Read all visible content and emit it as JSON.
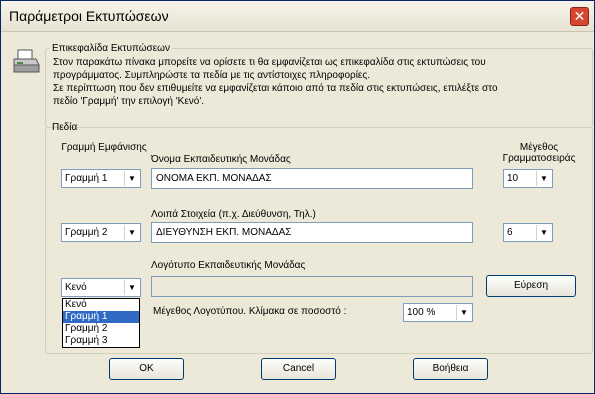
{
  "window": {
    "title": "Παράμετροι Εκτυπώσεων",
    "close_symbol": "✕"
  },
  "icons": {
    "printer": "printer-icon",
    "close": "close-icon",
    "chevron": "chevron-down-icon"
  },
  "header_group": {
    "legend": "Επικεφαλίδα Εκτυπώσεων",
    "line1": "Στον παρακάτω πίνακα μπορείτε να ορίσετε τι θα εμφανίζεται ως επικεφαλίδα στις εκτυπώσεις του",
    "line2": "προγράμματος. Συμπληρώστε τα πεδία με τις αντίστοιχες πληροφορίες.",
    "line3": "Σε περίπτωση που δεν επιθυμείτε να εμφανίζεται κάποιο από τα πεδία στις εκτυπώσεις, επιλέξτε στο",
    "line4": "πεδίο 'Γραμμή' την επιλογή 'Κενό'."
  },
  "fields_group": {
    "legend": "Πεδία",
    "col_line_header": "Γραμμή Εμφάνισης",
    "col_size_header": "Μέγεθος Γραμματοσειράς",
    "row1": {
      "label": "Όνομα Εκπαιδευτικής Μονάδας",
      "line": "Γραμμή 1",
      "value": "ΟΝΟΜΑ ΕΚΠ. ΜΟΝΑΔΑΣ",
      "size": "10"
    },
    "row2": {
      "label": "Λοιπά Στοιχεία (π.χ.  Διεύθυνση, Τηλ.)",
      "line": "Γραμμή 2",
      "value": "ΔΙΕΥΘΥΝΣΗ ΕΚΠ. ΜΟΝΑΔΑΣ",
      "size": "6"
    },
    "row3": {
      "label": "Λογότυπο Εκπαιδευτικής Μονάδας",
      "line": "Κενό",
      "value": "",
      "browse": "Εύρεση"
    },
    "logo_scale_label": "Μέγεθος Λογοτύπου. Κλίμακα σε ποσοστό :",
    "logo_scale_value": "100 %",
    "dropdown_options": [
      "Κενό",
      "Γραμμή 1",
      "Γραμμή 2",
      "Γραμμή 3"
    ],
    "dropdown_selected_index": 1
  },
  "buttons": {
    "ok": "OK",
    "cancel": "Cancel",
    "help": "Βοήθεια"
  }
}
